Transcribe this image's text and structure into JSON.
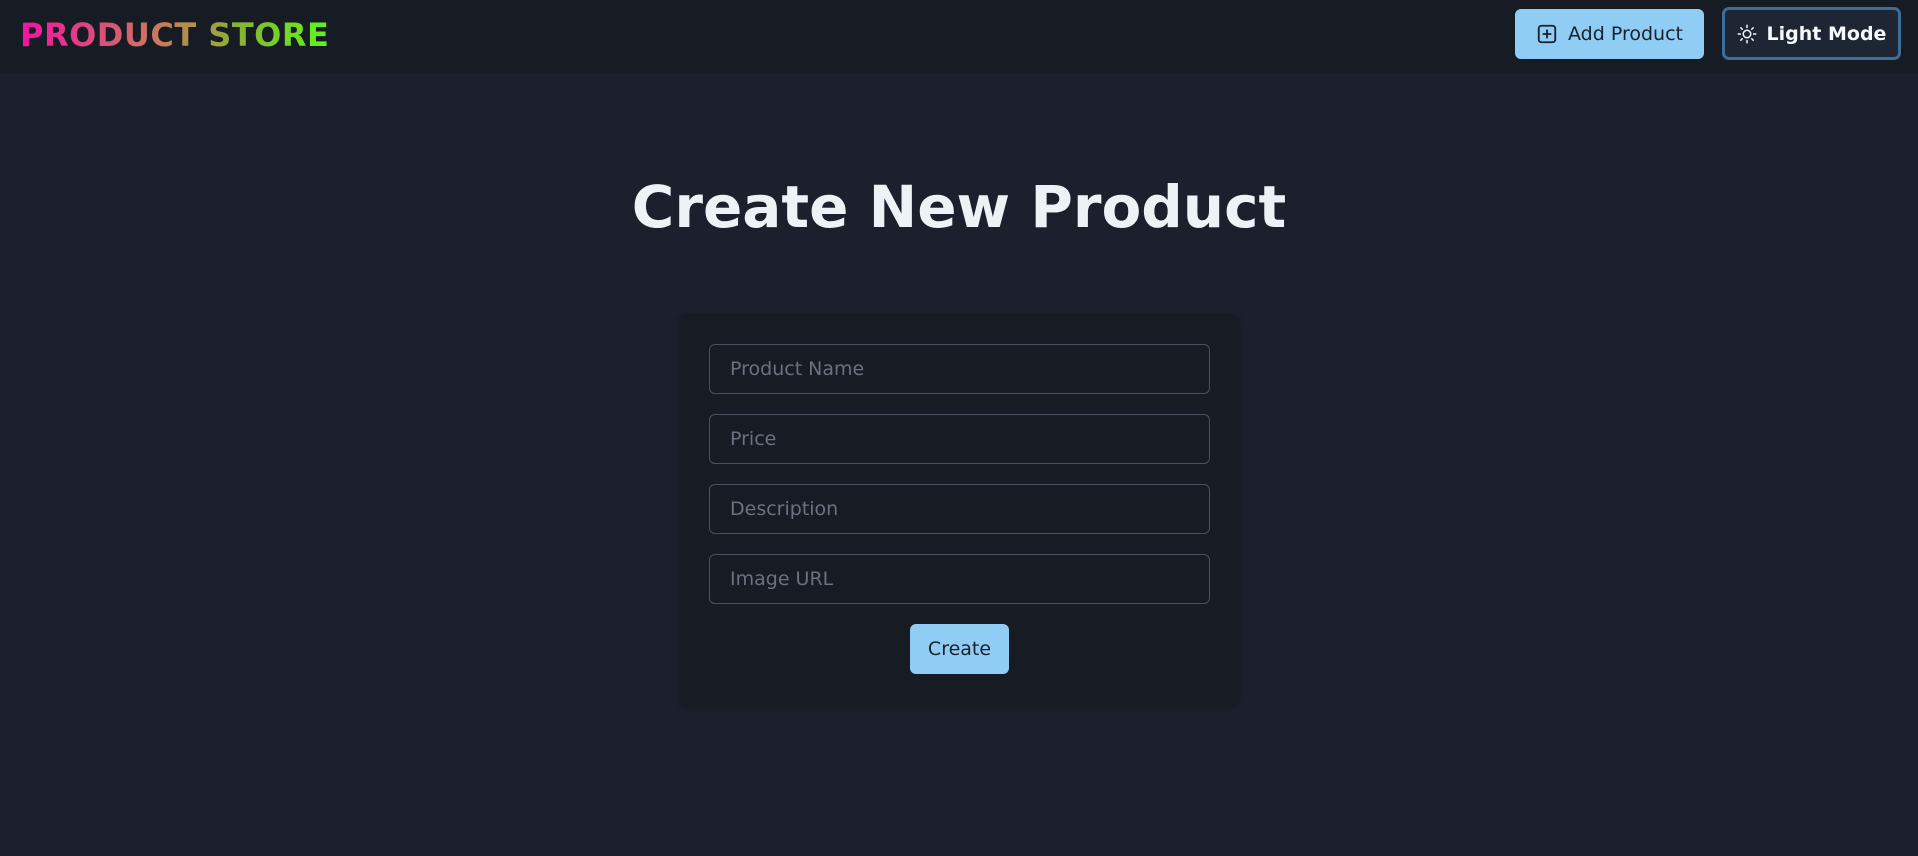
{
  "navbar": {
    "brand": "PRODUCT STORE",
    "add_product_label": "Add Product",
    "add_product_icon": "plus-square-icon",
    "theme_toggle_label": "Light Mode",
    "theme_toggle_icon": "sun-icon"
  },
  "page": {
    "title": "Create New Product"
  },
  "form": {
    "name_placeholder": "Product Name",
    "name_value": "",
    "price_placeholder": "Price",
    "price_value": "",
    "description_placeholder": "Description",
    "description_value": "",
    "image_placeholder": "Image URL",
    "image_value": "",
    "submit_label": "Create"
  },
  "colors": {
    "background": "#1b202c",
    "navbar": "#171b24",
    "accent": "#90cdf4",
    "brand_gradient": [
      "#f213a4",
      "#5df71a"
    ]
  }
}
